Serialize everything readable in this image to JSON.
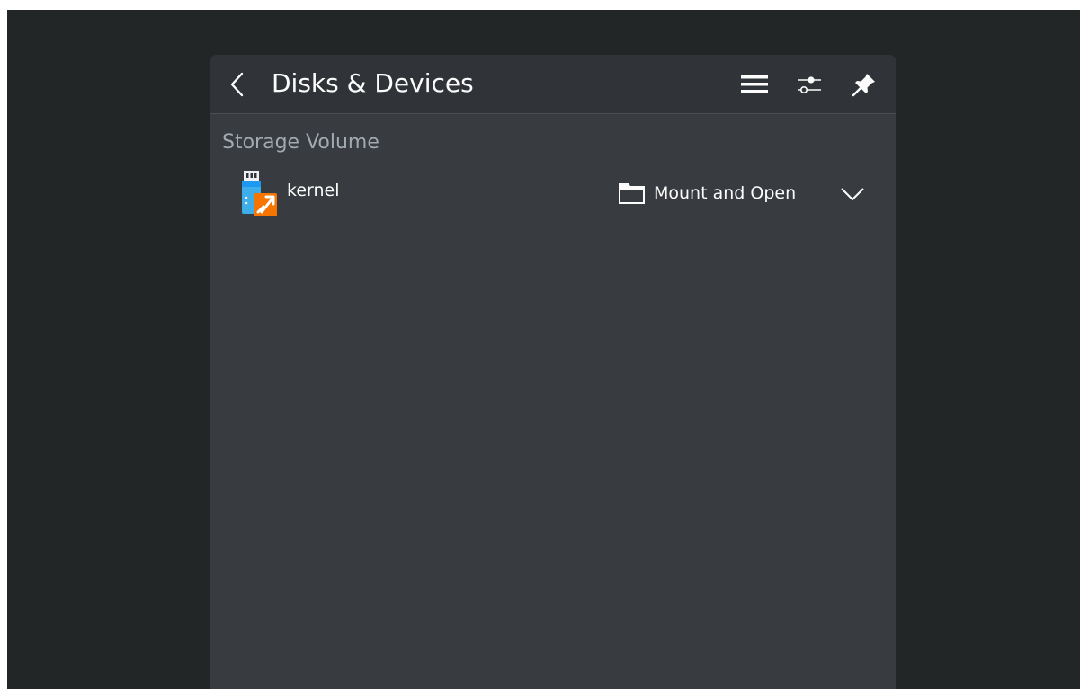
{
  "header": {
    "title": "Disks & Devices",
    "back_icon": "chevron-left-icon",
    "menu_icon": "hamburger-menu-icon",
    "settings_icon": "sliders-icon",
    "pin_icon": "pin-icon"
  },
  "section": {
    "label": "Storage Volume"
  },
  "devices": [
    {
      "name": "kernel",
      "icon": "usb-drive-icon",
      "action_label": "Mount and Open",
      "action_icon": "folder-icon",
      "expand_icon": "chevron-down-icon"
    }
  ],
  "colors": {
    "desktop_bg": "#232627",
    "popup_bg": "#383b3f",
    "header_bg": "#303337",
    "text_primary": "#fcfcfc",
    "text_secondary": "#a1a9b1",
    "usb_blue": "#3daee9",
    "usb_orange": "#f67400"
  }
}
